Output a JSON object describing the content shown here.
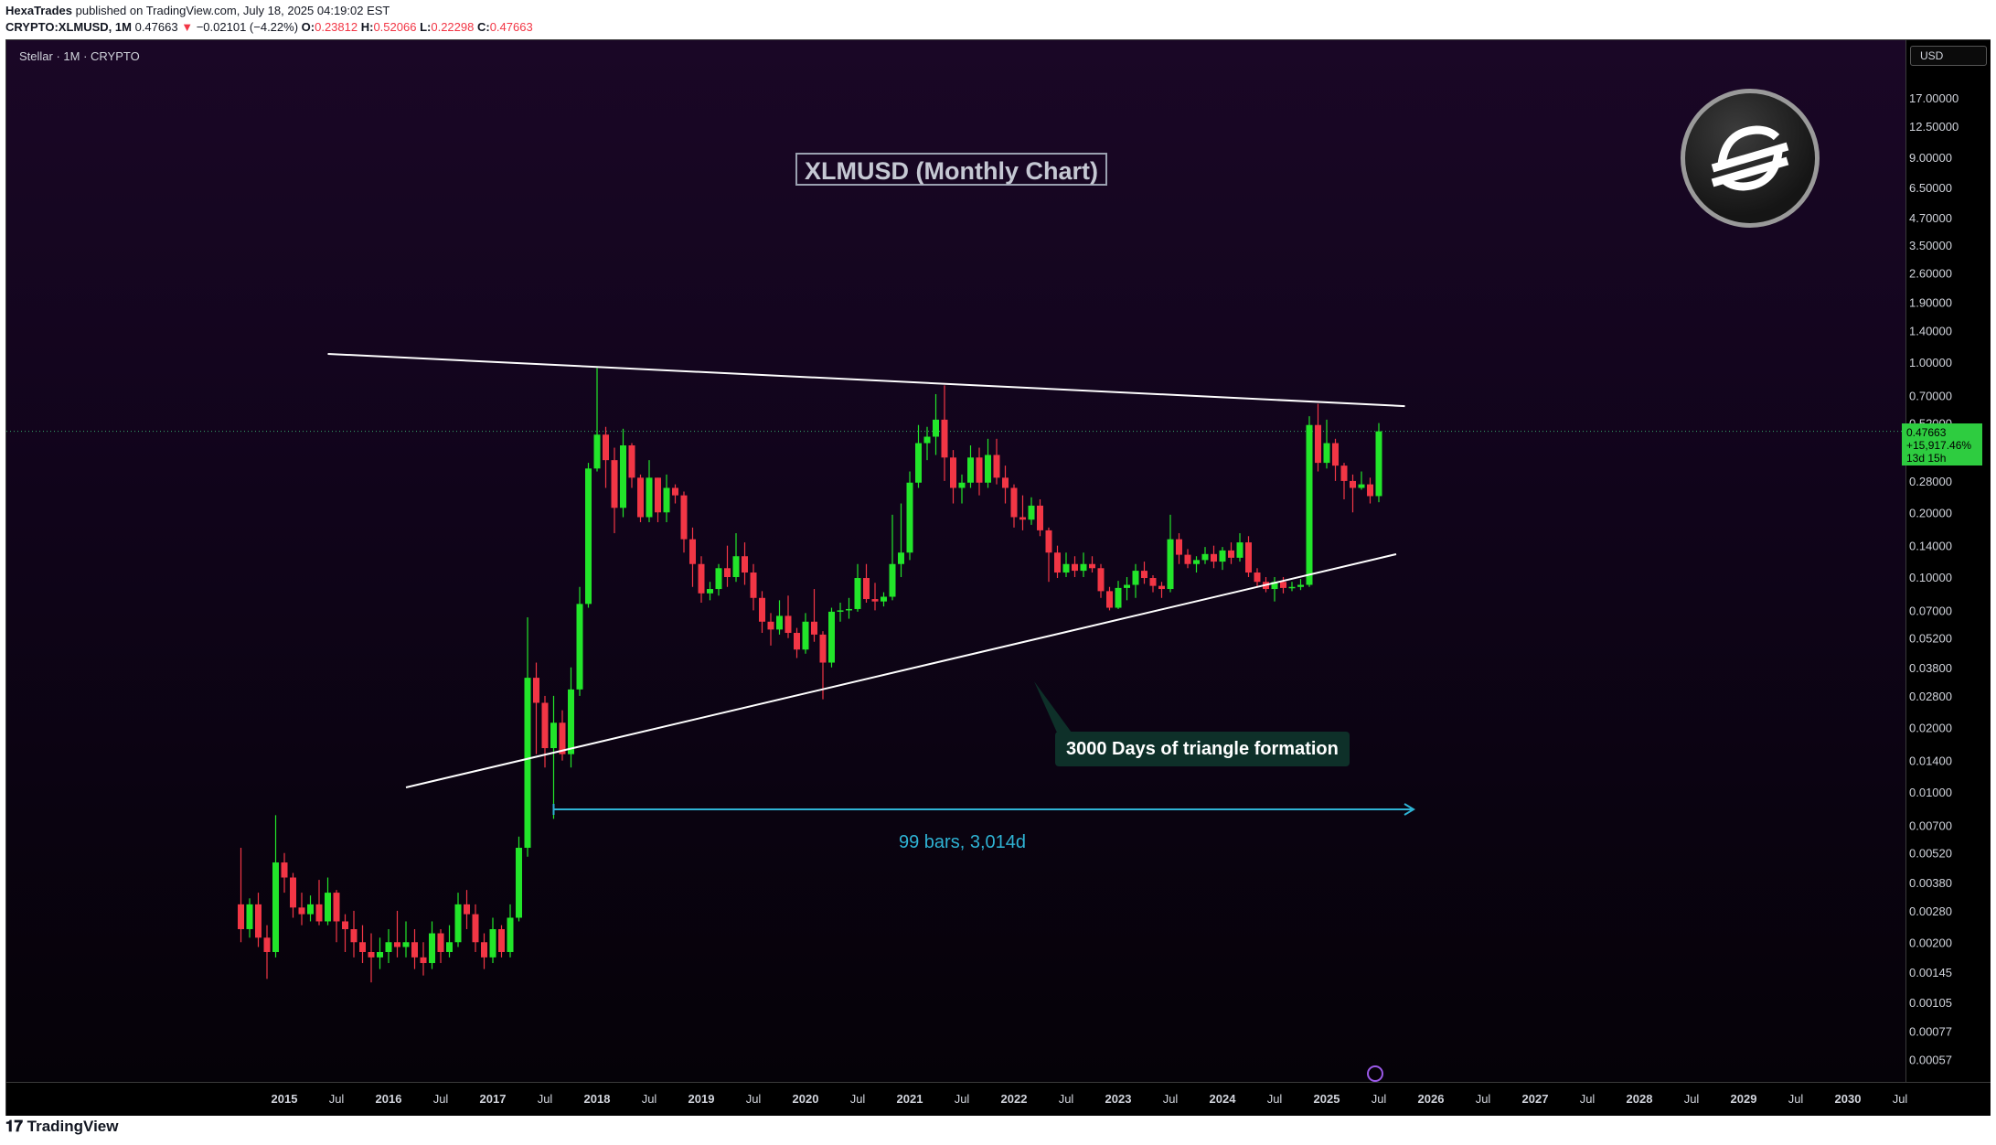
{
  "header": {
    "line1_author": "HexaTrades",
    "line1_rest": " published on TradingView.com, July 18, 2025 04:19:02 EST",
    "symbol": "CRYPTO:XLMUSD, 1M",
    "last": "0.47663",
    "change": "−0.02101 (−4.22%)",
    "open_label": "O:",
    "open": "0.23812",
    "high_label": "H:",
    "high": "0.52066",
    "low_label": "L:",
    "low": "0.22298",
    "close_label": "C:",
    "close": "0.47663"
  },
  "pane": {
    "legend": "Stellar · 1M · CRYPTO",
    "currency": "USD"
  },
  "annotations": {
    "title_box": "XLMUSD (Monthly Chart)",
    "callout": "3000 Days of triangle formation",
    "measure": "99 bars, 3,014d"
  },
  "price_label": {
    "value": "0.47663",
    "change": "+15,917.46%",
    "countdown": "13d 15h"
  },
  "footer": {
    "brand": "TradingView"
  },
  "colors": {
    "up": "#22e52a",
    "down": "#f23645",
    "trend": "#ffffff",
    "measure": "#2fb3d4"
  },
  "icons": {
    "logo": "stellar-logo-icon",
    "brand": "tradingview-logo-icon"
  },
  "chart_data": {
    "type": "candlestick",
    "y_scale": "log",
    "x_tick_labels": [
      "2015",
      "Jul",
      "2016",
      "Jul",
      "2017",
      "Jul",
      "2018",
      "Jul",
      "2019",
      "Jul",
      "2020",
      "Jul",
      "2021",
      "Jul",
      "2022",
      "Jul",
      "2023",
      "Jul",
      "2024",
      "Jul",
      "2025",
      "Jul",
      "2026",
      "Jul",
      "2027",
      "Jul",
      "2028",
      "Jul",
      "2029",
      "Jul",
      "2030",
      "Jul"
    ],
    "y_tick_labels": [
      "17.00000",
      "12.50000",
      "9.00000",
      "6.50000",
      "4.70000",
      "3.50000",
      "2.60000",
      "1.90000",
      "1.40000",
      "1.00000",
      "0.70000",
      "0.52000",
      "0.28000",
      "0.20000",
      "0.14000",
      "0.10000",
      "0.07000",
      "0.05200",
      "0.03800",
      "0.02800",
      "0.02000",
      "0.01400",
      "0.01000",
      "0.00700",
      "0.00520",
      "0.00380",
      "0.00280",
      "0.00200",
      "0.00145",
      "0.00105",
      "0.00077",
      "0.00057"
    ],
    "y_tick_values": [
      17,
      12.5,
      9,
      6.5,
      4.7,
      3.5,
      2.6,
      1.9,
      1.4,
      1.0,
      0.7,
      0.52,
      0.28,
      0.2,
      0.14,
      0.1,
      0.07,
      0.052,
      0.038,
      0.028,
      0.02,
      0.014,
      0.01,
      0.007,
      0.0052,
      0.0038,
      0.0028,
      0.002,
      0.00145,
      0.00105,
      0.00077,
      0.00057
    ],
    "candles": [
      {
        "t": "2014-08",
        "o": 0.003,
        "c": 0.0023,
        "h": 0.0055,
        "l": 0.002
      },
      {
        "t": "2014-09",
        "o": 0.0023,
        "c": 0.003,
        "h": 0.0032,
        "l": 0.0021
      },
      {
        "t": "2014-10",
        "o": 0.003,
        "c": 0.0021,
        "h": 0.0034,
        "l": 0.0019
      },
      {
        "t": "2014-11",
        "o": 0.0021,
        "c": 0.0018,
        "h": 0.0024,
        "l": 0.00135
      },
      {
        "t": "2014-12",
        "o": 0.0018,
        "c": 0.0047,
        "h": 0.0078,
        "l": 0.0017
      },
      {
        "t": "2015-01",
        "o": 0.0047,
        "c": 0.004,
        "h": 0.0052,
        "l": 0.0034
      },
      {
        "t": "2015-02",
        "o": 0.004,
        "c": 0.0029,
        "h": 0.0042,
        "l": 0.0026
      },
      {
        "t": "2015-03",
        "o": 0.0029,
        "c": 0.0027,
        "h": 0.0034,
        "l": 0.0024
      },
      {
        "t": "2015-04",
        "o": 0.0027,
        "c": 0.003,
        "h": 0.0033,
        "l": 0.0025
      },
      {
        "t": "2015-05",
        "o": 0.003,
        "c": 0.0025,
        "h": 0.0039,
        "l": 0.0024
      },
      {
        "t": "2015-06",
        "o": 0.0025,
        "c": 0.0034,
        "h": 0.004,
        "l": 0.0024
      },
      {
        "t": "2015-07",
        "o": 0.0034,
        "c": 0.0025,
        "h": 0.0035,
        "l": 0.002
      },
      {
        "t": "2015-08",
        "o": 0.0025,
        "c": 0.0023,
        "h": 0.0027,
        "l": 0.0018
      },
      {
        "t": "2015-09",
        "o": 0.0023,
        "c": 0.002,
        "h": 0.0028,
        "l": 0.0017
      },
      {
        "t": "2015-10",
        "o": 0.002,
        "c": 0.0018,
        "h": 0.0024,
        "l": 0.0016
      },
      {
        "t": "2015-11",
        "o": 0.0018,
        "c": 0.0017,
        "h": 0.0022,
        "l": 0.0013
      },
      {
        "t": "2015-12",
        "o": 0.0017,
        "c": 0.0018,
        "h": 0.0021,
        "l": 0.0015
      },
      {
        "t": "2016-01",
        "o": 0.0018,
        "c": 0.002,
        "h": 0.0023,
        "l": 0.0016
      },
      {
        "t": "2016-02",
        "o": 0.002,
        "c": 0.0019,
        "h": 0.0028,
        "l": 0.0017
      },
      {
        "t": "2016-03",
        "o": 0.0019,
        "c": 0.002,
        "h": 0.0025,
        "l": 0.0017
      },
      {
        "t": "2016-04",
        "o": 0.002,
        "c": 0.0017,
        "h": 0.0023,
        "l": 0.0015
      },
      {
        "t": "2016-05",
        "o": 0.0017,
        "c": 0.0016,
        "h": 0.002,
        "l": 0.0014
      },
      {
        "t": "2016-06",
        "o": 0.0016,
        "c": 0.0022,
        "h": 0.0025,
        "l": 0.0015
      },
      {
        "t": "2016-07",
        "o": 0.0022,
        "c": 0.0018,
        "h": 0.0023,
        "l": 0.0016
      },
      {
        "t": "2016-08",
        "o": 0.0018,
        "c": 0.002,
        "h": 0.0024,
        "l": 0.0017
      },
      {
        "t": "2016-09",
        "o": 0.002,
        "c": 0.003,
        "h": 0.0034,
        "l": 0.0019
      },
      {
        "t": "2016-10",
        "o": 0.003,
        "c": 0.0027,
        "h": 0.0035,
        "l": 0.0023
      },
      {
        "t": "2016-11",
        "o": 0.0027,
        "c": 0.002,
        "h": 0.003,
        "l": 0.0018
      },
      {
        "t": "2016-12",
        "o": 0.002,
        "c": 0.0017,
        "h": 0.0022,
        "l": 0.0015
      },
      {
        "t": "2017-01",
        "o": 0.0017,
        "c": 0.0023,
        "h": 0.0026,
        "l": 0.0016
      },
      {
        "t": "2017-02",
        "o": 0.0023,
        "c": 0.0018,
        "h": 0.0024,
        "l": 0.0017
      },
      {
        "t": "2017-03",
        "o": 0.0018,
        "c": 0.0026,
        "h": 0.003,
        "l": 0.0017
      },
      {
        "t": "2017-04",
        "o": 0.0026,
        "c": 0.0055,
        "h": 0.0062,
        "l": 0.0025
      },
      {
        "t": "2017-05",
        "o": 0.0055,
        "c": 0.034,
        "h": 0.065,
        "l": 0.005
      },
      {
        "t": "2017-06",
        "o": 0.034,
        "c": 0.026,
        "h": 0.04,
        "l": 0.015
      },
      {
        "t": "2017-07",
        "o": 0.026,
        "c": 0.016,
        "h": 0.028,
        "l": 0.013
      },
      {
        "t": "2017-08",
        "o": 0.016,
        "c": 0.021,
        "h": 0.028,
        "l": 0.0075
      },
      {
        "t": "2017-09",
        "o": 0.021,
        "c": 0.015,
        "h": 0.024,
        "l": 0.014
      },
      {
        "t": "2017-10",
        "o": 0.015,
        "c": 0.03,
        "h": 0.038,
        "l": 0.013
      },
      {
        "t": "2017-11",
        "o": 0.03,
        "c": 0.075,
        "h": 0.09,
        "l": 0.028
      },
      {
        "t": "2017-12",
        "o": 0.075,
        "c": 0.32,
        "h": 0.34,
        "l": 0.072
      },
      {
        "t": "2018-01",
        "o": 0.32,
        "c": 0.46,
        "h": 0.94,
        "l": 0.31
      },
      {
        "t": "2018-02",
        "o": 0.46,
        "c": 0.35,
        "h": 0.5,
        "l": 0.26
      },
      {
        "t": "2018-03",
        "o": 0.35,
        "c": 0.21,
        "h": 0.4,
        "l": 0.16
      },
      {
        "t": "2018-04",
        "o": 0.21,
        "c": 0.41,
        "h": 0.49,
        "l": 0.19
      },
      {
        "t": "2018-05",
        "o": 0.41,
        "c": 0.29,
        "h": 0.42,
        "l": 0.26
      },
      {
        "t": "2018-06",
        "o": 0.29,
        "c": 0.19,
        "h": 0.3,
        "l": 0.18
      },
      {
        "t": "2018-07",
        "o": 0.19,
        "c": 0.29,
        "h": 0.35,
        "l": 0.18
      },
      {
        "t": "2018-08",
        "o": 0.29,
        "c": 0.2,
        "h": 0.29,
        "l": 0.18
      },
      {
        "t": "2018-09",
        "o": 0.2,
        "c": 0.26,
        "h": 0.3,
        "l": 0.18
      },
      {
        "t": "2018-10",
        "o": 0.26,
        "c": 0.24,
        "h": 0.27,
        "l": 0.22
      },
      {
        "t": "2018-11",
        "o": 0.24,
        "c": 0.15,
        "h": 0.25,
        "l": 0.13
      },
      {
        "t": "2018-12",
        "o": 0.15,
        "c": 0.115,
        "h": 0.17,
        "l": 0.09
      },
      {
        "t": "2019-01",
        "o": 0.115,
        "c": 0.084,
        "h": 0.125,
        "l": 0.076
      },
      {
        "t": "2019-02",
        "o": 0.084,
        "c": 0.088,
        "h": 0.095,
        "l": 0.078
      },
      {
        "t": "2019-03",
        "o": 0.088,
        "c": 0.11,
        "h": 0.115,
        "l": 0.082
      },
      {
        "t": "2019-04",
        "o": 0.11,
        "c": 0.1,
        "h": 0.14,
        "l": 0.09
      },
      {
        "t": "2019-05",
        "o": 0.1,
        "c": 0.125,
        "h": 0.16,
        "l": 0.095
      },
      {
        "t": "2019-06",
        "o": 0.125,
        "c": 0.105,
        "h": 0.145,
        "l": 0.092
      },
      {
        "t": "2019-07",
        "o": 0.105,
        "c": 0.08,
        "h": 0.115,
        "l": 0.07
      },
      {
        "t": "2019-08",
        "o": 0.08,
        "c": 0.062,
        "h": 0.086,
        "l": 0.055
      },
      {
        "t": "2019-09",
        "o": 0.062,
        "c": 0.057,
        "h": 0.068,
        "l": 0.048
      },
      {
        "t": "2019-10",
        "o": 0.057,
        "c": 0.066,
        "h": 0.078,
        "l": 0.054
      },
      {
        "t": "2019-11",
        "o": 0.066,
        "c": 0.055,
        "h": 0.082,
        "l": 0.052
      },
      {
        "t": "2019-12",
        "o": 0.055,
        "c": 0.046,
        "h": 0.058,
        "l": 0.042
      },
      {
        "t": "2020-01",
        "o": 0.046,
        "c": 0.062,
        "h": 0.068,
        "l": 0.044
      },
      {
        "t": "2020-02",
        "o": 0.062,
        "c": 0.054,
        "h": 0.088,
        "l": 0.05
      },
      {
        "t": "2020-03",
        "o": 0.054,
        "c": 0.04,
        "h": 0.056,
        "l": 0.027
      },
      {
        "t": "2020-04",
        "o": 0.04,
        "c": 0.069,
        "h": 0.072,
        "l": 0.038
      },
      {
        "t": "2020-05",
        "o": 0.069,
        "c": 0.07,
        "h": 0.076,
        "l": 0.062
      },
      {
        "t": "2020-06",
        "o": 0.07,
        "c": 0.071,
        "h": 0.08,
        "l": 0.064
      },
      {
        "t": "2020-07",
        "o": 0.071,
        "c": 0.099,
        "h": 0.115,
        "l": 0.069
      },
      {
        "t": "2020-08",
        "o": 0.099,
        "c": 0.079,
        "h": 0.115,
        "l": 0.076
      },
      {
        "t": "2020-09",
        "o": 0.079,
        "c": 0.077,
        "h": 0.094,
        "l": 0.07
      },
      {
        "t": "2020-10",
        "o": 0.077,
        "c": 0.081,
        "h": 0.085,
        "l": 0.073
      },
      {
        "t": "2020-11",
        "o": 0.081,
        "c": 0.115,
        "h": 0.195,
        "l": 0.078
      },
      {
        "t": "2020-12",
        "o": 0.115,
        "c": 0.13,
        "h": 0.22,
        "l": 0.1
      },
      {
        "t": "2021-01",
        "o": 0.13,
        "c": 0.275,
        "h": 0.31,
        "l": 0.12
      },
      {
        "t": "2021-02",
        "o": 0.275,
        "c": 0.42,
        "h": 0.51,
        "l": 0.26
      },
      {
        "t": "2021-03",
        "o": 0.42,
        "c": 0.45,
        "h": 0.5,
        "l": 0.35
      },
      {
        "t": "2021-04",
        "o": 0.45,
        "c": 0.54,
        "h": 0.71,
        "l": 0.37
      },
      {
        "t": "2021-05",
        "o": 0.54,
        "c": 0.36,
        "h": 0.78,
        "l": 0.28
      },
      {
        "t": "2021-06",
        "o": 0.36,
        "c": 0.26,
        "h": 0.39,
        "l": 0.22
      },
      {
        "t": "2021-07",
        "o": 0.26,
        "c": 0.275,
        "h": 0.3,
        "l": 0.22
      },
      {
        "t": "2021-08",
        "o": 0.275,
        "c": 0.36,
        "h": 0.41,
        "l": 0.26
      },
      {
        "t": "2021-09",
        "o": 0.36,
        "c": 0.275,
        "h": 0.4,
        "l": 0.24
      },
      {
        "t": "2021-10",
        "o": 0.275,
        "c": 0.37,
        "h": 0.44,
        "l": 0.26
      },
      {
        "t": "2021-11",
        "o": 0.37,
        "c": 0.29,
        "h": 0.44,
        "l": 0.27
      },
      {
        "t": "2021-12",
        "o": 0.29,
        "c": 0.26,
        "h": 0.33,
        "l": 0.22
      },
      {
        "t": "2022-01",
        "o": 0.26,
        "c": 0.19,
        "h": 0.27,
        "l": 0.17
      },
      {
        "t": "2022-02",
        "o": 0.19,
        "c": 0.185,
        "h": 0.24,
        "l": 0.165
      },
      {
        "t": "2022-03",
        "o": 0.185,
        "c": 0.215,
        "h": 0.235,
        "l": 0.175
      },
      {
        "t": "2022-04",
        "o": 0.215,
        "c": 0.165,
        "h": 0.23,
        "l": 0.155
      },
      {
        "t": "2022-05",
        "o": 0.165,
        "c": 0.13,
        "h": 0.17,
        "l": 0.095
      },
      {
        "t": "2022-06",
        "o": 0.13,
        "c": 0.105,
        "h": 0.14,
        "l": 0.099
      },
      {
        "t": "2022-07",
        "o": 0.105,
        "c": 0.115,
        "h": 0.13,
        "l": 0.1
      },
      {
        "t": "2022-08",
        "o": 0.115,
        "c": 0.107,
        "h": 0.125,
        "l": 0.1
      },
      {
        "t": "2022-09",
        "o": 0.107,
        "c": 0.115,
        "h": 0.13,
        "l": 0.1
      },
      {
        "t": "2022-10",
        "o": 0.115,
        "c": 0.11,
        "h": 0.125,
        "l": 0.105
      },
      {
        "t": "2022-11",
        "o": 0.11,
        "c": 0.086,
        "h": 0.115,
        "l": 0.08
      },
      {
        "t": "2022-12",
        "o": 0.086,
        "c": 0.072,
        "h": 0.09,
        "l": 0.07
      },
      {
        "t": "2023-01",
        "o": 0.072,
        "c": 0.089,
        "h": 0.096,
        "l": 0.071
      },
      {
        "t": "2023-02",
        "o": 0.089,
        "c": 0.092,
        "h": 0.1,
        "l": 0.078
      },
      {
        "t": "2023-03",
        "o": 0.092,
        "c": 0.107,
        "h": 0.115,
        "l": 0.08
      },
      {
        "t": "2023-04",
        "o": 0.107,
        "c": 0.099,
        "h": 0.118,
        "l": 0.093
      },
      {
        "t": "2023-05",
        "o": 0.099,
        "c": 0.091,
        "h": 0.102,
        "l": 0.085
      },
      {
        "t": "2023-06",
        "o": 0.091,
        "c": 0.088,
        "h": 0.095,
        "l": 0.08
      },
      {
        "t": "2023-07",
        "o": 0.088,
        "c": 0.15,
        "h": 0.195,
        "l": 0.085
      },
      {
        "t": "2023-08",
        "o": 0.15,
        "c": 0.127,
        "h": 0.16,
        "l": 0.115
      },
      {
        "t": "2023-09",
        "o": 0.127,
        "c": 0.115,
        "h": 0.135,
        "l": 0.11
      },
      {
        "t": "2023-10",
        "o": 0.115,
        "c": 0.12,
        "h": 0.125,
        "l": 0.105
      },
      {
        "t": "2023-11",
        "o": 0.12,
        "c": 0.128,
        "h": 0.138,
        "l": 0.115
      },
      {
        "t": "2023-12",
        "o": 0.128,
        "c": 0.118,
        "h": 0.14,
        "l": 0.11
      },
      {
        "t": "2024-01",
        "o": 0.118,
        "c": 0.133,
        "h": 0.138,
        "l": 0.108
      },
      {
        "t": "2024-02",
        "o": 0.133,
        "c": 0.123,
        "h": 0.145,
        "l": 0.115
      },
      {
        "t": "2024-03",
        "o": 0.123,
        "c": 0.145,
        "h": 0.16,
        "l": 0.118
      },
      {
        "t": "2024-04",
        "o": 0.145,
        "c": 0.105,
        "h": 0.155,
        "l": 0.1
      },
      {
        "t": "2024-05",
        "o": 0.105,
        "c": 0.095,
        "h": 0.11,
        "l": 0.09
      },
      {
        "t": "2024-06",
        "o": 0.095,
        "c": 0.088,
        "h": 0.1,
        "l": 0.085
      },
      {
        "t": "2024-07",
        "o": 0.088,
        "c": 0.095,
        "h": 0.1,
        "l": 0.077
      },
      {
        "t": "2024-08",
        "o": 0.095,
        "c": 0.089,
        "h": 0.1,
        "l": 0.084
      },
      {
        "t": "2024-09",
        "o": 0.089,
        "c": 0.09,
        "h": 0.095,
        "l": 0.086
      },
      {
        "t": "2024-10",
        "o": 0.09,
        "c": 0.092,
        "h": 0.098,
        "l": 0.087
      },
      {
        "t": "2024-11",
        "o": 0.092,
        "c": 0.51,
        "h": 0.56,
        "l": 0.09
      },
      {
        "t": "2024-12",
        "o": 0.51,
        "c": 0.34,
        "h": 0.64,
        "l": 0.31
      },
      {
        "t": "2025-01",
        "o": 0.34,
        "c": 0.42,
        "h": 0.54,
        "l": 0.32
      },
      {
        "t": "2025-02",
        "o": 0.42,
        "c": 0.33,
        "h": 0.44,
        "l": 0.28
      },
      {
        "t": "2025-03",
        "o": 0.33,
        "c": 0.28,
        "h": 0.34,
        "l": 0.23
      },
      {
        "t": "2025-04",
        "o": 0.28,
        "c": 0.26,
        "h": 0.3,
        "l": 0.2
      },
      {
        "t": "2025-05",
        "o": 0.26,
        "c": 0.27,
        "h": 0.31,
        "l": 0.255
      },
      {
        "t": "2025-06",
        "o": 0.27,
        "c": 0.238,
        "h": 0.29,
        "l": 0.22
      },
      {
        "t": "2025-07",
        "o": 0.2381,
        "c": 0.4766,
        "h": 0.5207,
        "l": 0.223
      }
    ]
  }
}
